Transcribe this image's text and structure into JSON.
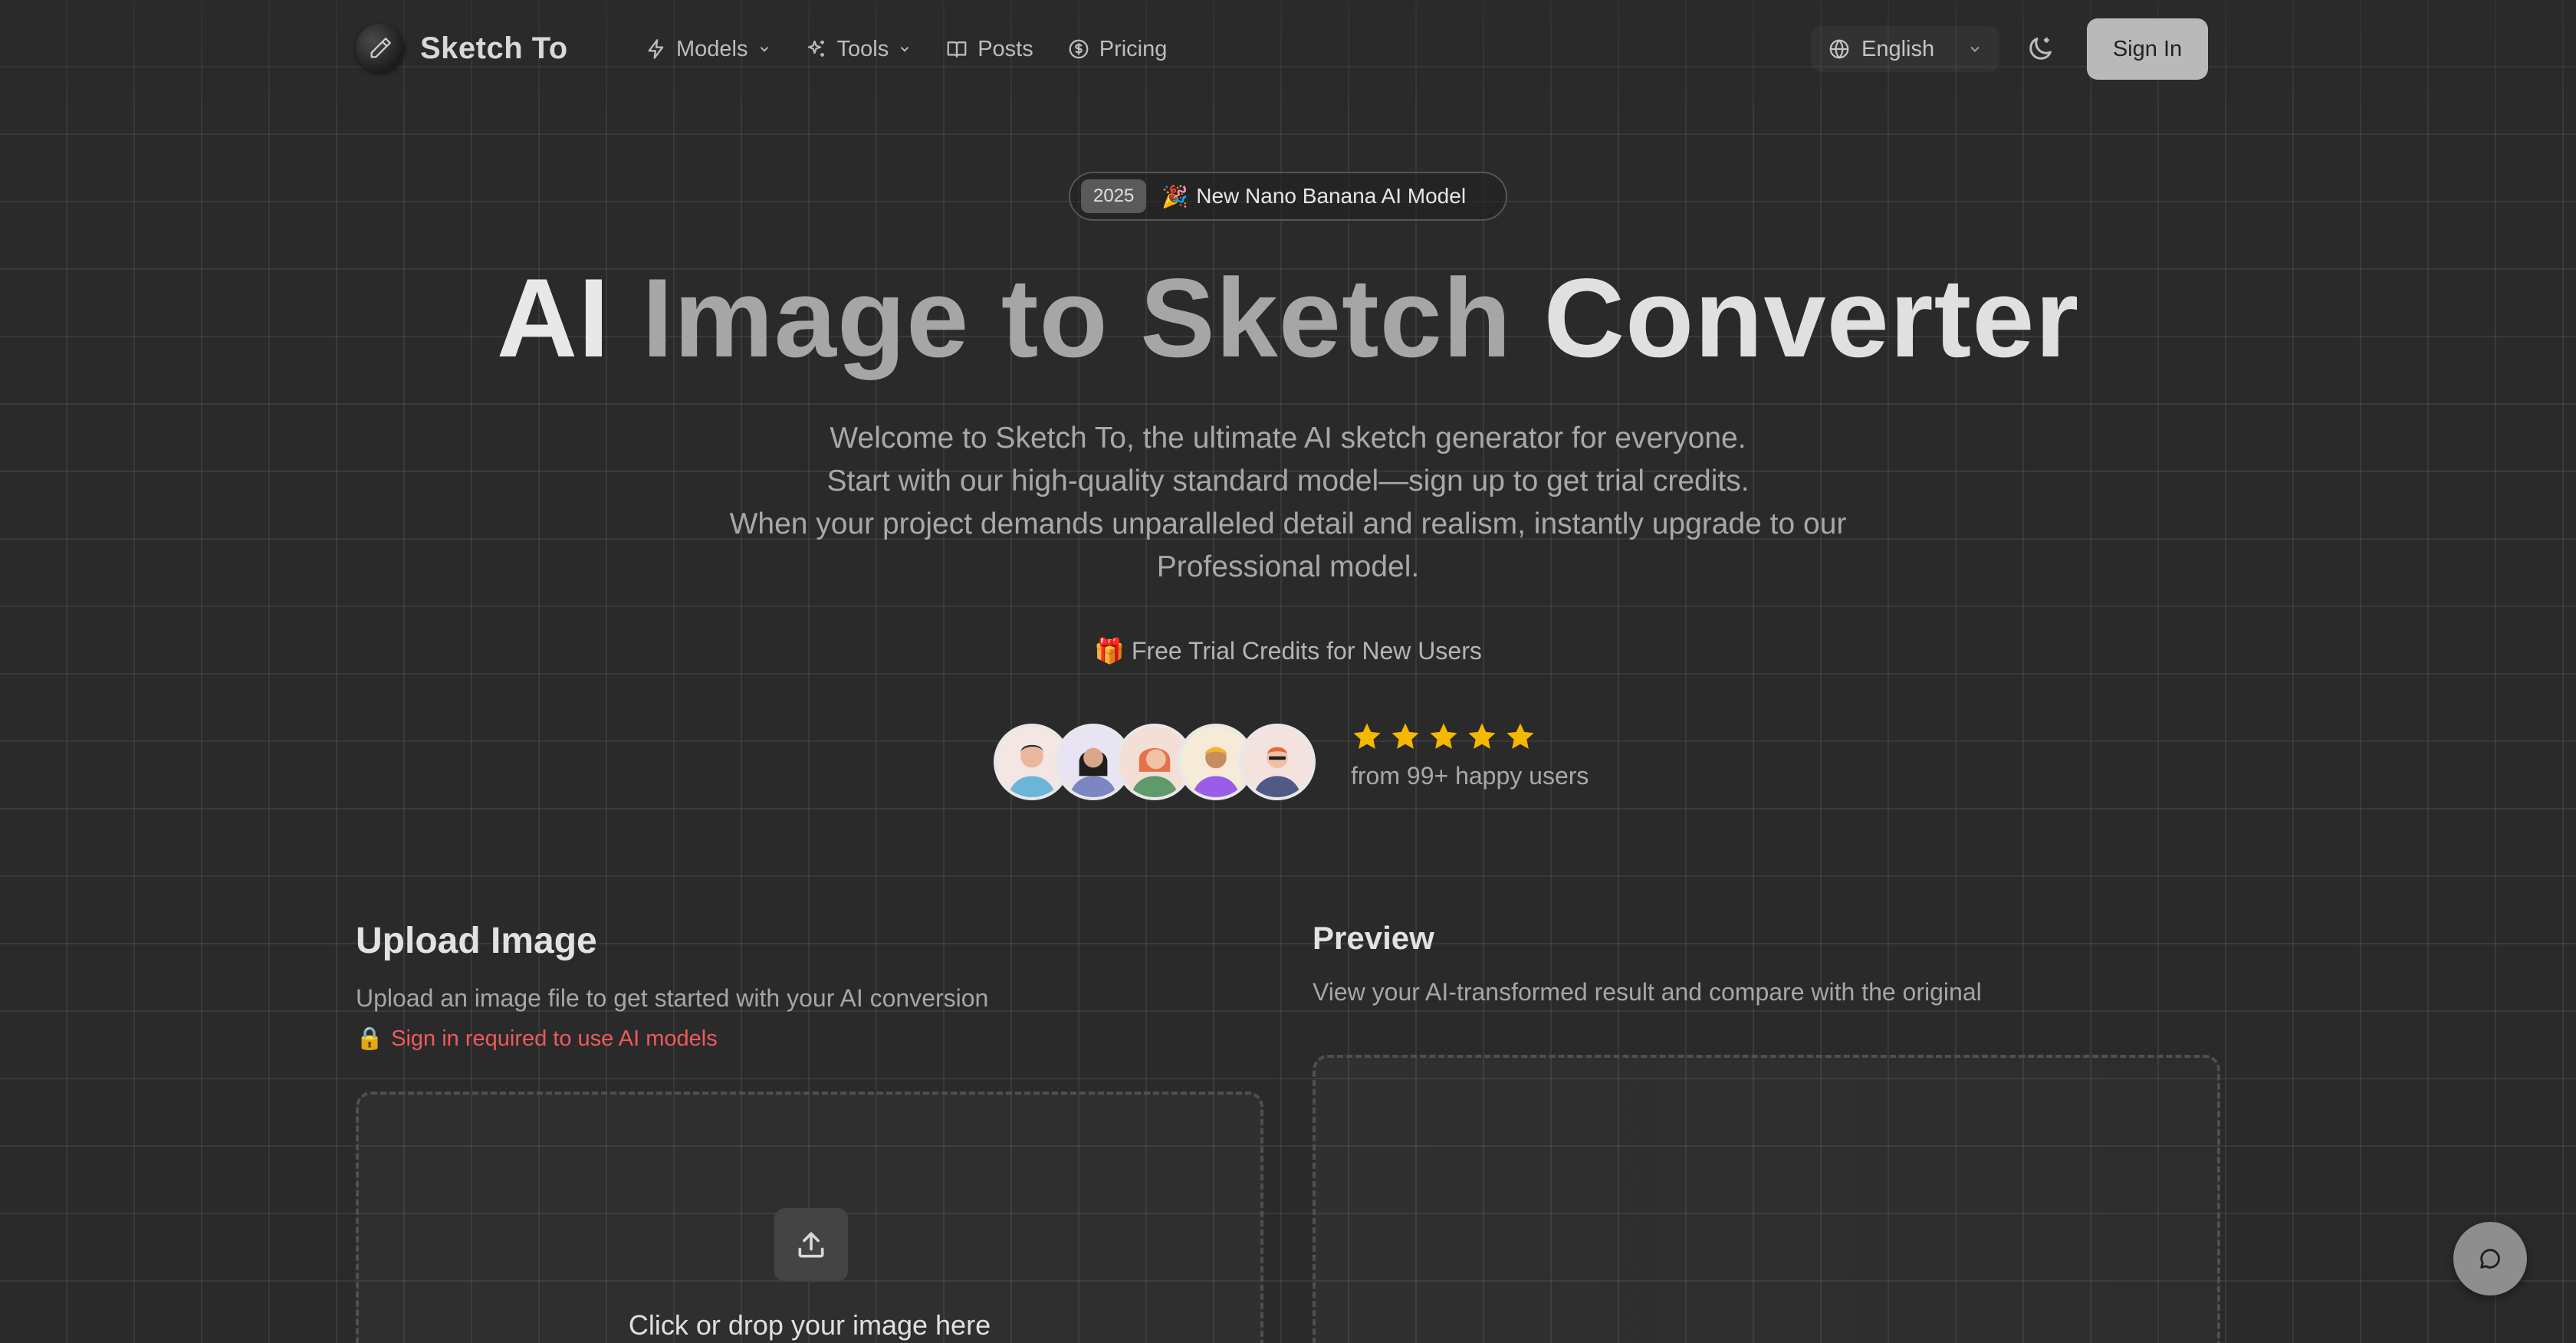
{
  "header": {
    "logo_text": "Sketch To",
    "nav": [
      {
        "label": "Models",
        "icon": "bolt-icon",
        "has_dropdown": true
      },
      {
        "label": "Tools",
        "icon": "sparkles-icon",
        "has_dropdown": true
      },
      {
        "label": "Posts",
        "icon": "book-icon",
        "has_dropdown": false
      },
      {
        "label": "Pricing",
        "icon": "dollar-circle-icon",
        "has_dropdown": false
      }
    ],
    "language": "English",
    "sign_in": "Sign In"
  },
  "hero": {
    "badge_year": "2025",
    "badge_emoji": "🎉",
    "badge_text": "New Nano Banana AI Model",
    "title_part1": "AI",
    "title_part2": "Image to Sketch",
    "title_part3": "Converter",
    "subtitle_lines": [
      "Welcome to Sketch To, the ultimate AI sketch generator for everyone.",
      "Start with our high-quality standard model—sign up to get trial credits.",
      "When your project demands unparalleled detail and realism, instantly upgrade to our",
      "Professional model."
    ],
    "trial_emoji": "🎁",
    "trial_text": "Free Trial Credits for New Users",
    "rating_stars": 5,
    "happy_users": "from 99+ happy users"
  },
  "upload": {
    "title": "Upload Image",
    "description": "Upload an image file to get started with your AI conversion",
    "warning_emoji": "🔒",
    "warning": "Sign in required to use AI models",
    "drop_text": "Click or drop your image here"
  },
  "preview": {
    "title": "Preview",
    "description": "View your AI-transformed result and compare with the original"
  },
  "colors": {
    "background": "#2a2a2a",
    "accent_star": "#f5b800",
    "warning": "#ef5a5a",
    "sign_in_bg": "#b9b9b9"
  }
}
